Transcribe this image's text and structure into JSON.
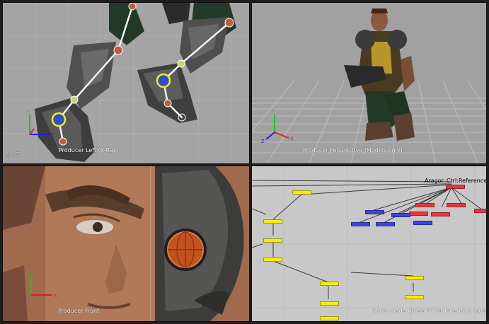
{
  "viewports": {
    "left": {
      "label": "Producer Left (X-Ray)",
      "corner_text": "Z : Y"
    },
    "perspective": {
      "label": "Producer Perspective (Models only)"
    },
    "front": {
      "label": "Producer Front"
    },
    "relations": {
      "label": "Move mode (Press 'P' for Parenting mode )",
      "root_label": "Aragor_Ctrl:Reference"
    }
  },
  "axis_letters": {
    "x": "X",
    "y": "Y",
    "z": "Z"
  },
  "colors": {
    "viewport_bg": "#a3a3a3",
    "relations_bg": "#c9c9c9",
    "node_yellow": "#f4ee10",
    "node_blue": "#3f42e6",
    "node_red": "#e8363c",
    "axis_red": "#e02020",
    "axis_green": "#20c020",
    "axis_blue": "#2020e0"
  }
}
